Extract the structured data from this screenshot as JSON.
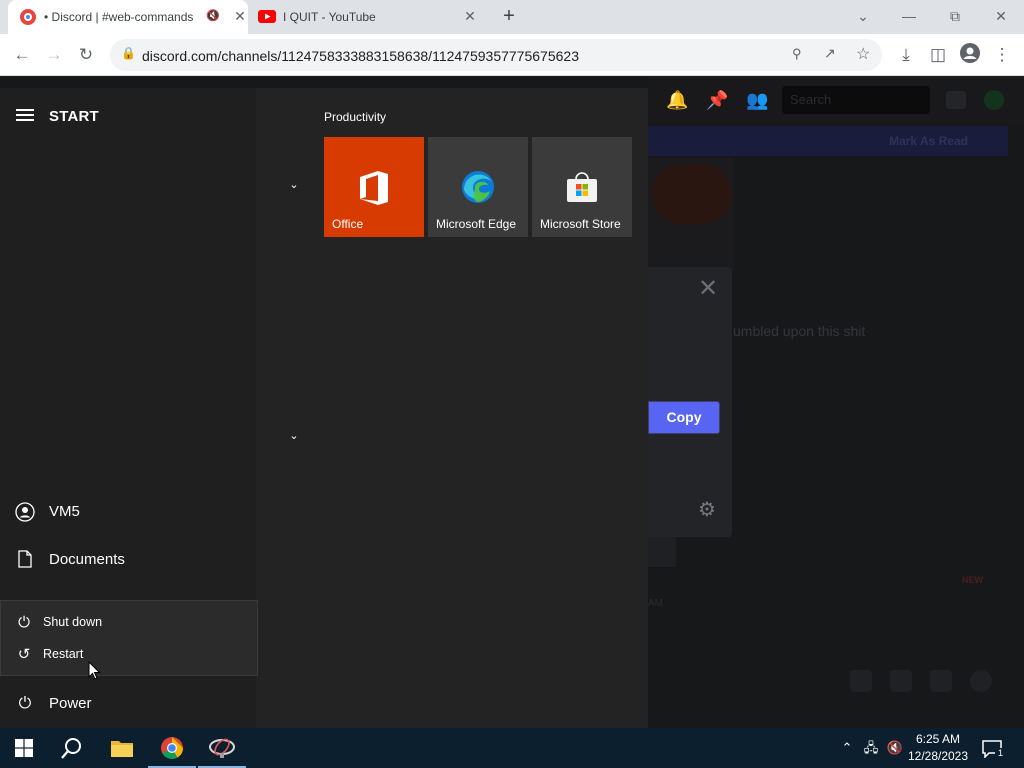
{
  "browser": {
    "tabs": [
      {
        "title": "• Discord | #web-commands",
        "active": true
      },
      {
        "title": "I QUIT - YouTube",
        "active": false
      }
    ],
    "new_tab_label": "+",
    "address": "discord.com/channels/1124758333883158638/1124759357775675623"
  },
  "discord": {
    "search_placeholder": "Search",
    "banner_text": "Mark As Read",
    "message_fragment": "umbled upon this shit",
    "copy_label": "Copy",
    "new_badge": "NEW",
    "time_fragment": "AM"
  },
  "start_menu": {
    "title": "START",
    "user": "VM5",
    "documents": "Documents",
    "power": "Power",
    "power_menu": {
      "shutdown": "Shut down",
      "restart": "Restart"
    },
    "group_title": "Productivity",
    "tiles": [
      {
        "label": "Office",
        "color": "#d83b01"
      },
      {
        "label": "Microsoft Edge",
        "color": "#3b3b3b"
      },
      {
        "label": "Microsoft Store",
        "color": "#3b3b3b"
      }
    ]
  },
  "taskbar": {
    "time": "6:25 AM",
    "date": "12/28/2023",
    "notification_count": "1",
    "items": [
      "start-icon",
      "search-icon",
      "file-explorer-icon",
      "chrome-icon",
      "network-app-icon"
    ]
  },
  "colors": {
    "accent_blue": "#5865f2",
    "office_orange": "#d83b01",
    "taskbar": "#0c1f2e"
  }
}
